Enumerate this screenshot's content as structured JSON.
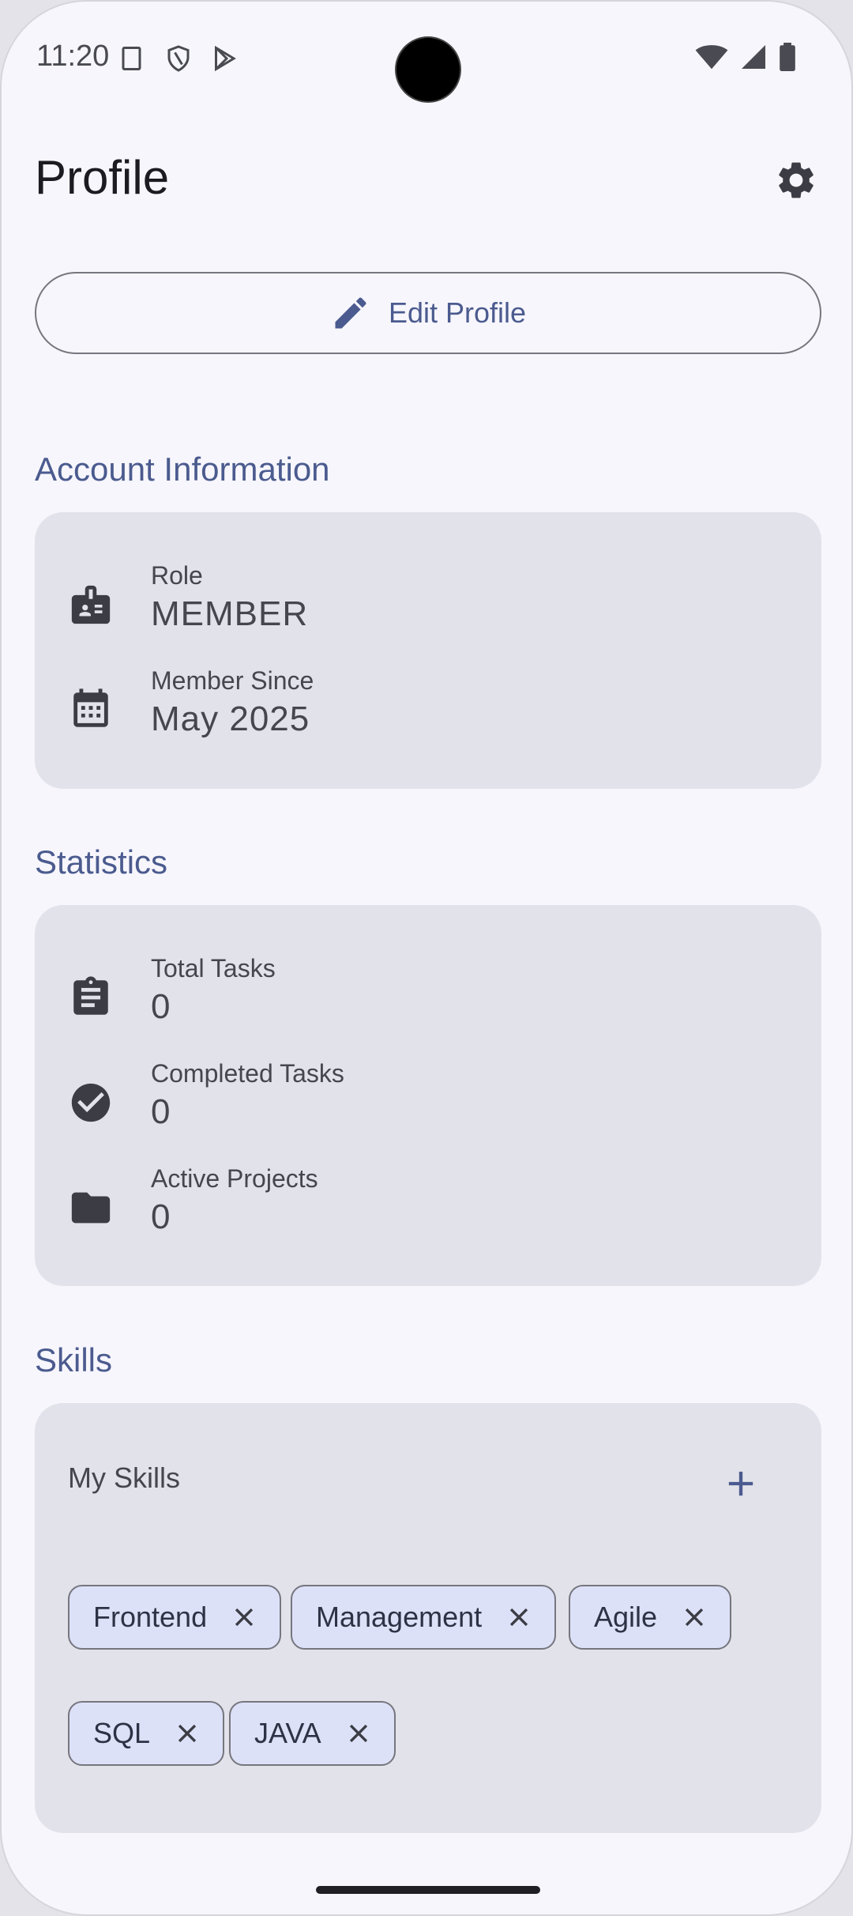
{
  "status_bar": {
    "time": "11:20"
  },
  "header": {
    "title": "Profile"
  },
  "edit_button": {
    "label": "Edit Profile"
  },
  "account": {
    "title": "Account Information",
    "rows": [
      {
        "label": "Role",
        "value": "MEMBER",
        "icon": "badge-icon"
      },
      {
        "label": "Member Since",
        "value": "May 2025",
        "icon": "calendar-icon"
      }
    ]
  },
  "statistics": {
    "title": "Statistics",
    "rows": [
      {
        "label": "Total Tasks",
        "value": "0",
        "icon": "clipboard-icon"
      },
      {
        "label": "Completed Tasks",
        "value": "0",
        "icon": "check-circle-icon"
      },
      {
        "label": "Active Projects",
        "value": "0",
        "icon": "folder-icon"
      }
    ]
  },
  "skills": {
    "title": "Skills",
    "heading": "My Skills",
    "chips": [
      "Frontend",
      "Management",
      "Agile",
      "SQL",
      "JAVA"
    ]
  },
  "colors": {
    "accent": "#4b5b8f",
    "card": "#e2e2ea",
    "chip": "#dde1f8",
    "background": "#f7f6fc"
  }
}
